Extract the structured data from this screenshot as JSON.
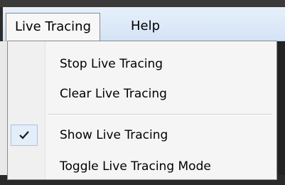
{
  "menubar": {
    "items": [
      {
        "label": "Live Tracing"
      },
      {
        "label": "Help"
      }
    ]
  },
  "dropdown": {
    "items": [
      {
        "label": "Stop Live Tracing",
        "checked": false
      },
      {
        "label": "Clear Live Tracing",
        "checked": false
      },
      {
        "label": "Show Live Tracing",
        "checked": true
      },
      {
        "label": "Toggle Live Tracing Mode",
        "checked": false
      }
    ]
  },
  "colors": {
    "menubar_bg": "#d4e3f5",
    "check_highlight": "#e3eefb"
  }
}
